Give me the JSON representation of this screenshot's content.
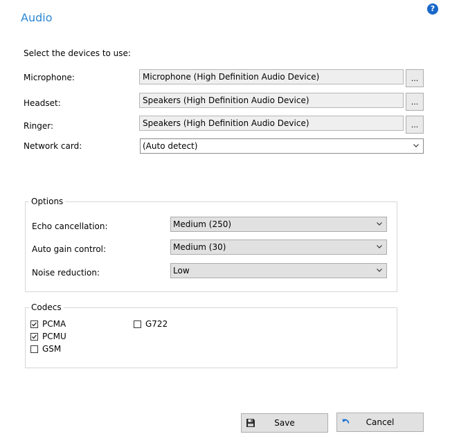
{
  "header": {
    "title": "Audio",
    "help_icon": "?"
  },
  "devices": {
    "intro": "Select the devices to use:",
    "microphone_label": "Microphone:",
    "microphone_value": "Microphone (High Definition Audio Device)",
    "headset_label": "Headset:",
    "headset_value": "Speakers (High Definition Audio Device)",
    "ringer_label": "Ringer:",
    "ringer_value": "Speakers (High Definition Audio Device)",
    "browse_label": "...",
    "network_label": "Network card:",
    "network_value": "(Auto detect)"
  },
  "options": {
    "legend": "Options",
    "echo_label": "Echo cancellation:",
    "echo_value": "Medium (250)",
    "agc_label": "Auto gain control:",
    "agc_value": "Medium (30)",
    "noise_label": "Noise reduction:",
    "noise_value": "Low"
  },
  "codecs": {
    "legend": "Codecs",
    "items": [
      {
        "label": "PCMA",
        "checked": true
      },
      {
        "label": "PCMU",
        "checked": true
      },
      {
        "label": "GSM",
        "checked": false
      },
      {
        "label": "G722",
        "checked": false
      }
    ]
  },
  "buttons": {
    "save_label": "Save",
    "cancel_label": "Cancel"
  },
  "icons": {
    "help": "help-icon",
    "save": "floppy-disk-icon",
    "cancel": "undo-arrow-icon"
  },
  "colors": {
    "title": "#2b87d3",
    "help_icon": "#1868c8",
    "cancel_icon": "#1a6fd1"
  }
}
